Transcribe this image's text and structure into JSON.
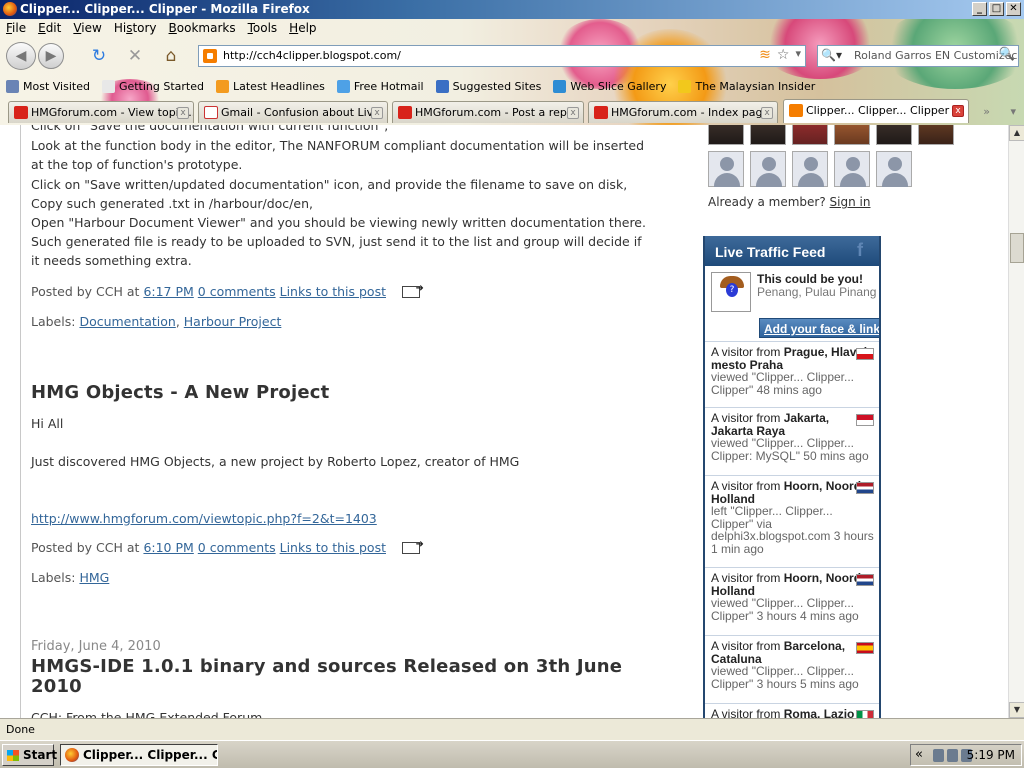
{
  "window": {
    "title": "Clipper... Clipper... Clipper - Mozilla Firefox",
    "buttons": {
      "minimize": "_",
      "maximize": "□",
      "close": "✕"
    }
  },
  "menu": [
    "File",
    "Edit",
    "View",
    "History",
    "Bookmarks",
    "Tools",
    "Help"
  ],
  "menu_mnemonics": [
    "F",
    "E",
    "V",
    "s",
    "B",
    "T",
    "H"
  ],
  "nav": {
    "url": "http://cch4clipper.blogspot.com/",
    "search_text": "Roland Garros EN Customizec",
    "icons": {
      "back": "◀",
      "forward": "▶",
      "reload": "↻",
      "stop": "✕",
      "home": "⌂",
      "rss": "≋",
      "star": "☆",
      "dropdown": "▾",
      "search_engine": "🔍▾",
      "search_go": "🔍"
    }
  },
  "bookmarks": [
    {
      "label": "Most Visited",
      "color": "#6a84b5"
    },
    {
      "label": "Getting Started",
      "color": "#e8e8e8"
    },
    {
      "label": "Latest Headlines",
      "color": "#f39b1f"
    },
    {
      "label": "Free Hotmail",
      "color": "#4ea1e6"
    },
    {
      "label": "Suggested Sites",
      "color": "#3b6fc4"
    },
    {
      "label": "Web Slice Gallery",
      "color": "#2e8cd4"
    },
    {
      "label": "The Malaysian Insider",
      "color": "#f2c81c"
    }
  ],
  "tabs": [
    {
      "label": "HMGforum.com - View topic...",
      "color": "#d8231a",
      "active": false
    },
    {
      "label": "Gmail - Confusion about Liv...",
      "color": "#ffffff",
      "active": false
    },
    {
      "label": "HMGforum.com - Post a reply",
      "color": "#d8231a",
      "active": false
    },
    {
      "label": "HMGforum.com - Index page",
      "color": "#d8231a",
      "active": false
    },
    {
      "label": "Clipper... Clipper... Clipper",
      "color": "#f57d00",
      "active": true
    }
  ],
  "tab_controls": {
    "scroll": "»",
    "list": "▾",
    "close": "x"
  },
  "post1": {
    "cut_line": "Click on \"Save the documentation with current function\",",
    "lines": [
      "Look at the function body in the editor, The NANFORUM compliant documentation will be inserted",
      "at the top of function's prototype.",
      "Click on \"Save written/updated documentation\" icon, and provide the filename to save on disk,",
      "Copy such generated .txt in /harbour/doc/en,",
      "Open \"Harbour Document Viewer\" and you should be viewing newly written documentation there.",
      "Such generated file is ready to be uploaded to SVN, just send it to the list and group will decide if",
      "it needs something extra."
    ],
    "posted_by": "Posted by CCH at",
    "time": "6:17 PM",
    "comments": "0 comments",
    "links": "Links to this post",
    "labels_prefix": "Labels:",
    "labels": [
      "Documentation",
      "Harbour Project"
    ],
    "separator": ","
  },
  "post2": {
    "title": "HMG Objects - A New Project",
    "greeting": "Hi All",
    "body": "Just discovered HMG Objects, a new project by Roberto Lopez, creator of HMG",
    "link": "http://www.hmgforum.com/viewtopic.php?f=2&t=1403",
    "posted_by": "Posted by CCH at",
    "time": "6:10 PM",
    "comments": "0 comments",
    "links": "Links to this post",
    "labels_prefix": "Labels:",
    "labels": [
      "HMG"
    ]
  },
  "post3": {
    "date": "Friday, June 4, 2010",
    "title_line1": "HMGS-IDE 1.0.1 binary and sources Released on 3th June",
    "title_line2": "2010",
    "cut_line": "CCH: From the HMG Extended Forum"
  },
  "sidebar": {
    "already_member": "Already a member?",
    "sign_in": "Sign in",
    "feed": {
      "title": "Live Traffic Feed",
      "fb_icon": "f",
      "you_title": "This could be you!",
      "you_location": "Penang, Pulau Pinang",
      "add_link": "Add your face & link!",
      "face_mark": "?",
      "entries": [
        {
          "prefix": "A visitor from",
          "place": "Prague, Hlavni mesto Praha",
          "action": "viewed",
          "detail": "\"Clipper... Clipper... Clipper\" 48 mins ago",
          "flag": "cz"
        },
        {
          "prefix": "A visitor from",
          "place": "Jakarta, Jakarta Raya",
          "action": "viewed",
          "detail": "\"Clipper... Clipper... Clipper: MySQL\" 50 mins ago",
          "flag": "id"
        },
        {
          "prefix": "A visitor from",
          "place": "Hoorn, Noord-Holland",
          "action": "left",
          "detail": "\"Clipper... Clipper... Clipper\" via delphi3x.blogspot.com 3 hours 1 min ago",
          "flag": "nl"
        },
        {
          "prefix": "A visitor from",
          "place": "Hoorn, Noord-Holland",
          "action": "viewed",
          "detail": "\"Clipper... Clipper... Clipper\" 3 hours 4 mins ago",
          "flag": "nl"
        },
        {
          "prefix": "A visitor from",
          "place": "Barcelona, Cataluna",
          "action": "viewed",
          "detail": "\"Clipper... Clipper... Clipper\" 3 hours 5 mins ago",
          "flag": "es"
        },
        {
          "prefix": "A visitor from",
          "place": "Roma, Lazio",
          "action": "",
          "detail": "",
          "flag": "it"
        }
      ]
    }
  },
  "scrollbar": {
    "up": "▲",
    "down": "▼"
  },
  "status": "Done",
  "taskbar": {
    "start": "Start",
    "task": "Clipper... Clipper... Clip...",
    "tray_chevron": "«",
    "clock": "5:19 PM"
  }
}
